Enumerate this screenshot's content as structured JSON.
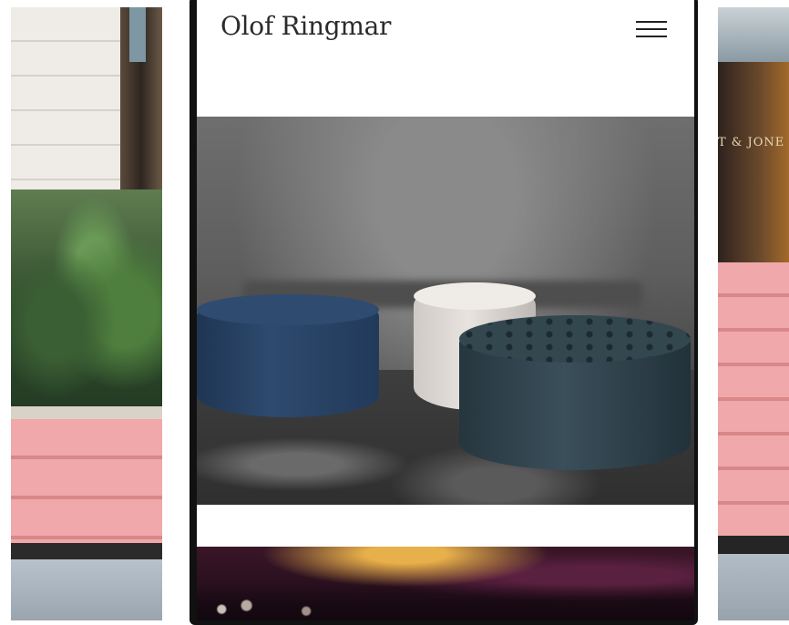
{
  "site": {
    "title": "Olof Ringmar"
  },
  "header": {
    "menu_icon": "hamburger-menu-icon"
  },
  "gallery": {
    "items": [
      {
        "icon": "photo-image"
      },
      {
        "icon": "photo-image"
      }
    ]
  },
  "side_screens": {
    "right_sign_text": "T & JONE"
  },
  "colors": {
    "page_background": "#ffffff",
    "phone_bezel": "#111111",
    "title_text": "#2b2b2b",
    "planter_pink": "#f0a8aa"
  }
}
